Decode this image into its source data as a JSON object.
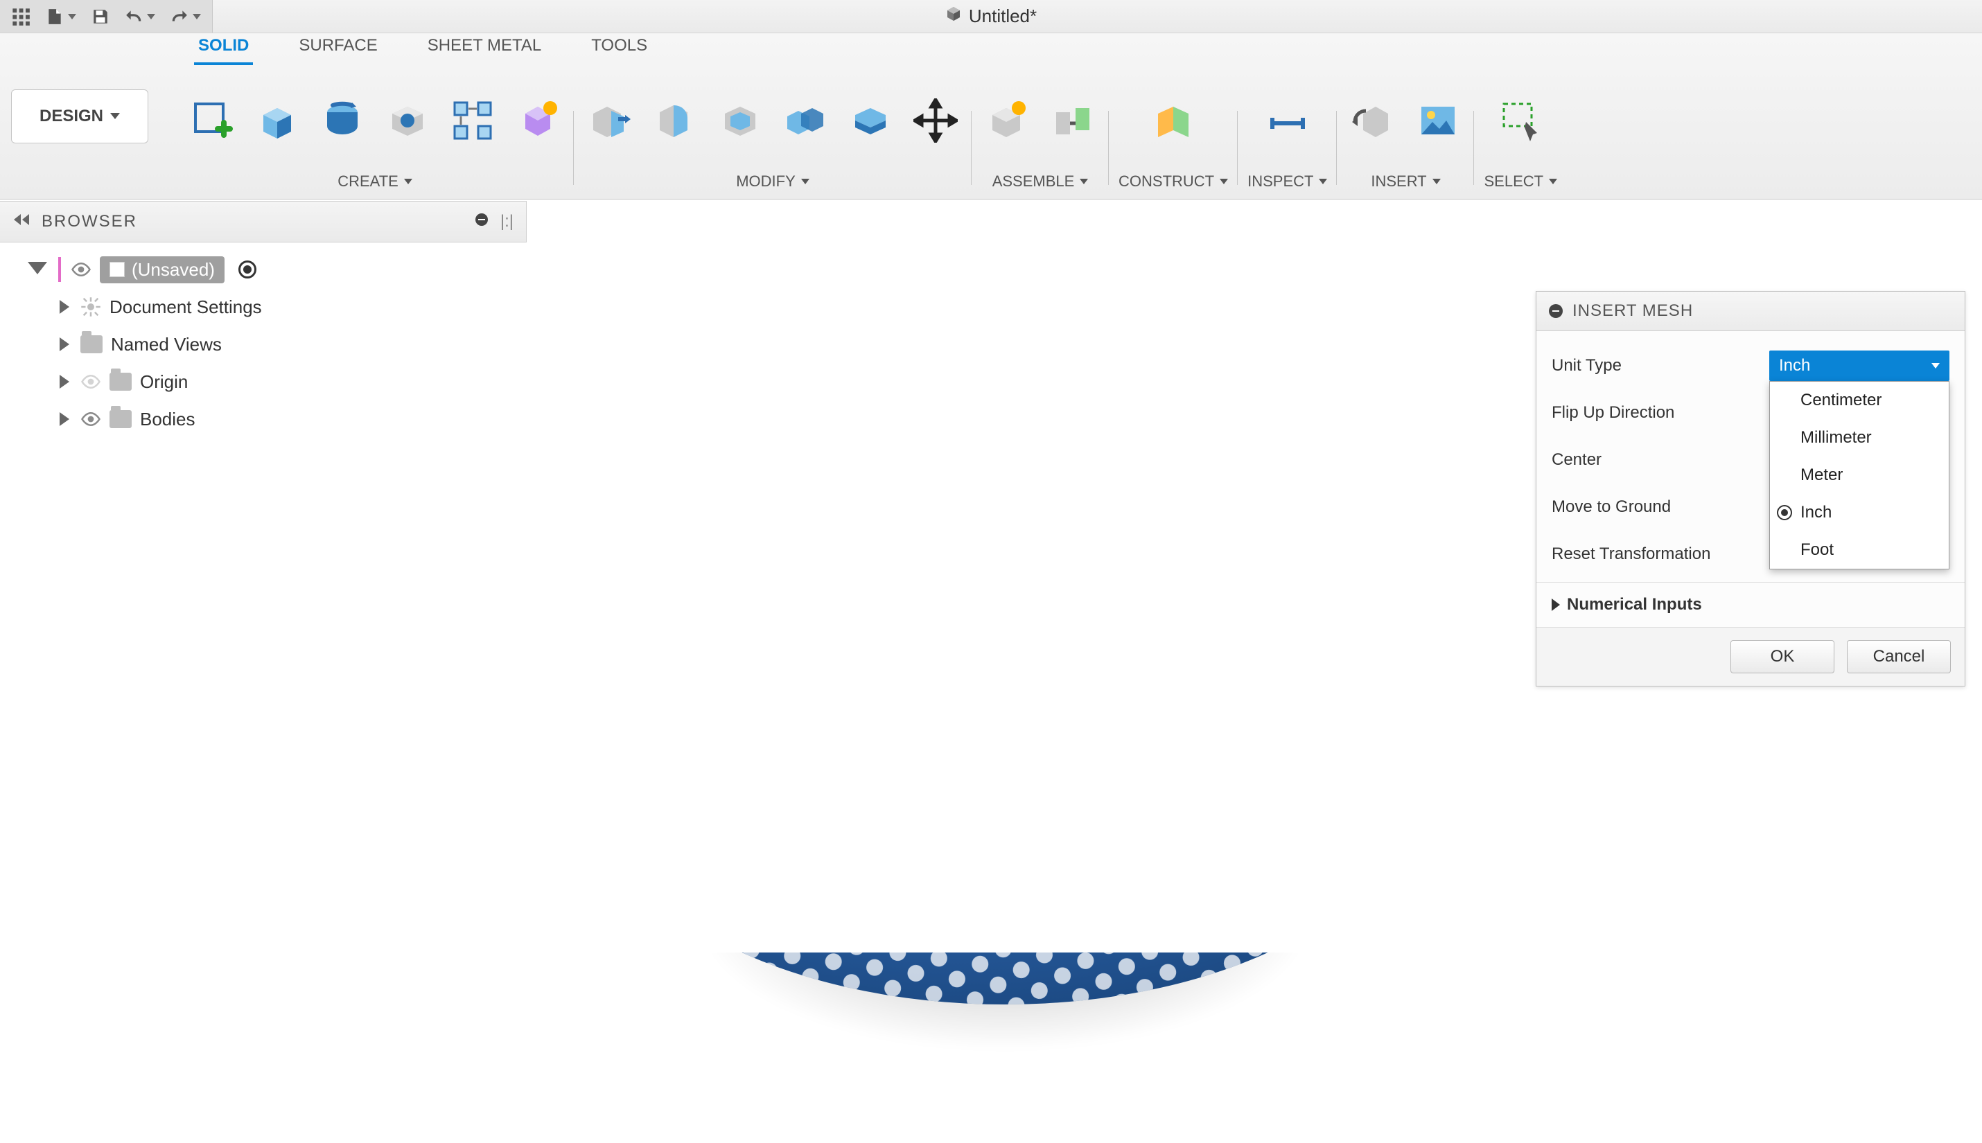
{
  "document": {
    "title": "Untitled*"
  },
  "qat": {
    "items": [
      {
        "name": "waffle-menu-icon"
      },
      {
        "name": "file-new-icon"
      },
      {
        "name": "save-icon"
      },
      {
        "name": "undo-icon"
      },
      {
        "name": "redo-icon"
      }
    ]
  },
  "workspace": {
    "label": "DESIGN"
  },
  "ribbon": {
    "tabs": [
      {
        "label": "SOLID",
        "active": true
      },
      {
        "label": "SURFACE",
        "active": false
      },
      {
        "label": "SHEET METAL",
        "active": false
      },
      {
        "label": "TOOLS",
        "active": false
      }
    ],
    "groups": {
      "create": {
        "label": "CREATE"
      },
      "modify": {
        "label": "MODIFY"
      },
      "assemble": {
        "label": "ASSEMBLE"
      },
      "construct": {
        "label": "CONSTRUCT"
      },
      "inspect": {
        "label": "INSPECT"
      },
      "insert": {
        "label": "INSERT"
      },
      "select": {
        "label": "SELECT"
      }
    }
  },
  "browser": {
    "title": "BROWSER",
    "root": "(Unsaved)",
    "items": [
      {
        "label": "Document Settings"
      },
      {
        "label": "Named Views"
      },
      {
        "label": "Origin"
      },
      {
        "label": "Bodies"
      }
    ]
  },
  "panel": {
    "title": "INSERT MESH",
    "rows": {
      "unit_type": {
        "label": "Unit Type",
        "value": "Inch"
      },
      "flip_up": {
        "label": "Flip Up Direction"
      },
      "center": {
        "label": "Center"
      },
      "move_ground": {
        "label": "Move to Ground"
      },
      "reset": {
        "label": "Reset Transformation"
      }
    },
    "unit_options": [
      {
        "label": "Centimeter",
        "selected": false
      },
      {
        "label": "Millimeter",
        "selected": false
      },
      {
        "label": "Meter",
        "selected": false
      },
      {
        "label": "Inch",
        "selected": true
      },
      {
        "label": "Foot",
        "selected": false
      }
    ],
    "section_numerical": "Numerical Inputs",
    "ok": "OK",
    "cancel": "Cancel"
  }
}
